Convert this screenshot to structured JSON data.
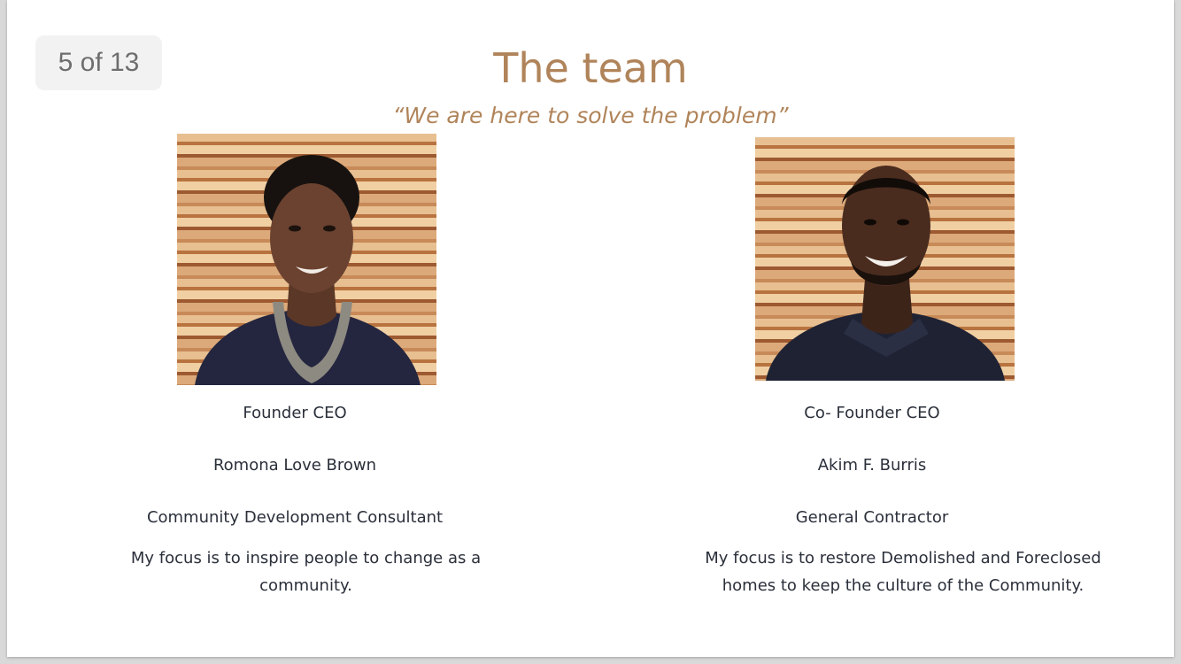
{
  "viewer": {
    "page_counter": "5 of 13"
  },
  "slide": {
    "title": "The team",
    "subtitle": "“We are here to solve the problem”",
    "members": [
      {
        "role": "Founder CEO",
        "name": "Romona Love Brown",
        "job_title": "Community Development Consultant",
        "focus": "My focus is to inspire people to change as a community."
      },
      {
        "role": "Co- Founder CEO",
        "name": "Akim F. Burris",
        "job_title": "General Contractor",
        "focus": "My focus is to restore Demolished and Foreclosed homes to keep the culture of the Community."
      }
    ]
  },
  "colors": {
    "accent": "#b0845a",
    "body_text": "#2a2f3a",
    "counter_bg": "#f2f2f2",
    "counter_text": "#6e6e6e"
  }
}
